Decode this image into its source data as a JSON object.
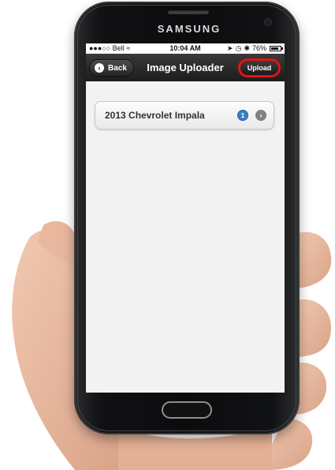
{
  "device": {
    "brand": "SAMSUNG"
  },
  "status_bar": {
    "carrier": "●●●○○ Bell",
    "time": "10:04 AM",
    "battery_percent": "76%",
    "icons": [
      "wifi-icon",
      "location-icon",
      "alarm-icon",
      "bluetooth-icon",
      "battery-icon"
    ]
  },
  "navbar": {
    "back_label": "Back",
    "title": "Image Uploader",
    "upload_label": "Upload",
    "upload_highlight_color": "#e11414"
  },
  "list": {
    "items": [
      {
        "label": "2013 Chevrolet Impala",
        "count": "1"
      }
    ]
  },
  "colors": {
    "navbar_bg": "#1c1c1c",
    "screen_bg": "#f2f2f2",
    "badge": "#3e7cc3"
  }
}
